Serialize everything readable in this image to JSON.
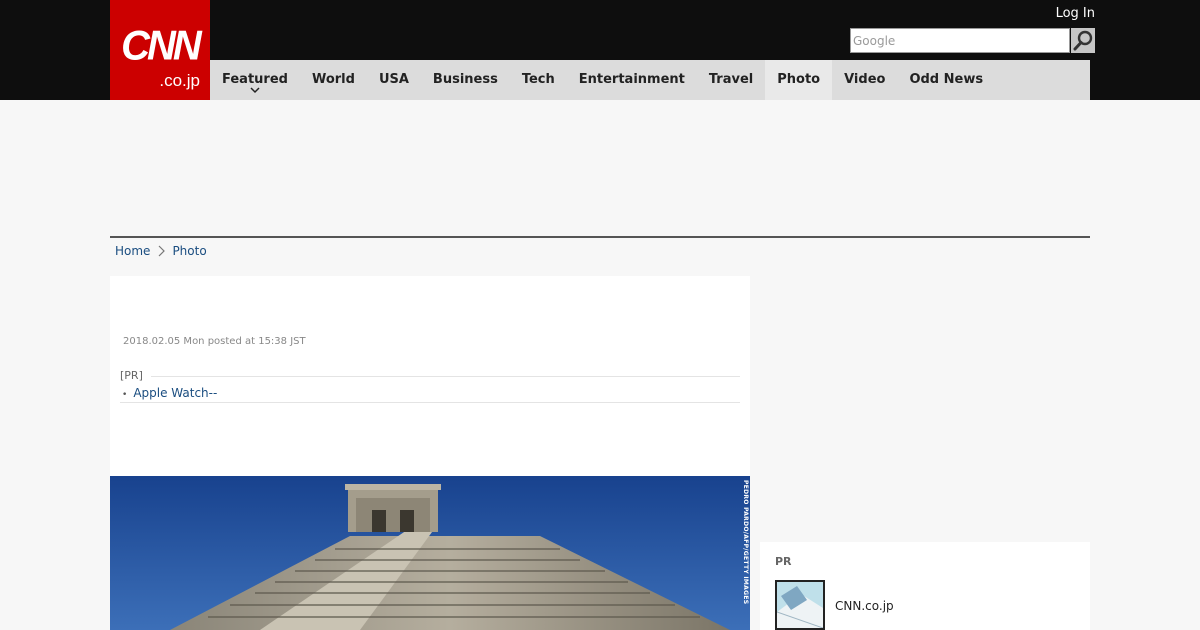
{
  "header": {
    "logo_main": "CNN",
    "logo_sub": ".co.jp",
    "login_label": "Log In",
    "search_placeholder": "Google"
  },
  "nav": {
    "items": [
      {
        "label": "Featured",
        "has_dropdown": true
      },
      {
        "label": "World"
      },
      {
        "label": "USA"
      },
      {
        "label": "Business"
      },
      {
        "label": "Tech"
      },
      {
        "label": "Entertainment"
      },
      {
        "label": "Travel"
      },
      {
        "label": "Photo",
        "active": true
      },
      {
        "label": "Video"
      },
      {
        "label": "Odd News"
      }
    ]
  },
  "breadcrumb": {
    "home": "Home",
    "current": "Photo"
  },
  "article": {
    "posted": "2018.02.05 Mon posted at 15:38 JST",
    "pr_label": "[PR]",
    "pr_link": "Apple Watch--",
    "photo_credit": "PEDRO PARDO/AFP/GETTY IMAGES"
  },
  "sidebar": {
    "pr_title": "PR",
    "pr_item_name": "CNN.co.jp"
  },
  "colors": {
    "brand_red": "#cc0000",
    "topbar": "#0e0e0e",
    "nav_bg": "#dcdcdc",
    "link": "#1a4d80"
  }
}
